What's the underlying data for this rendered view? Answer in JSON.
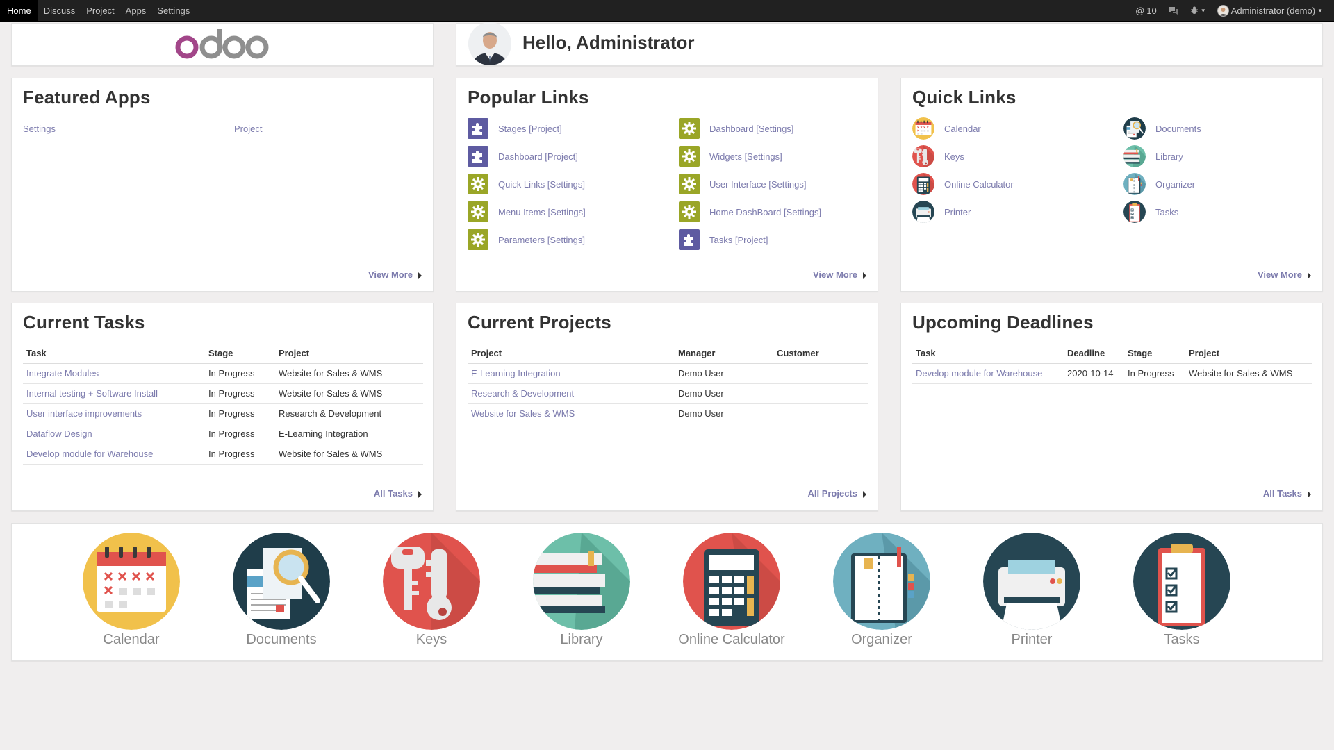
{
  "nav": {
    "items": [
      {
        "label": "Home",
        "active": true
      },
      {
        "label": "Discuss"
      },
      {
        "label": "Project"
      },
      {
        "label": "Apps"
      },
      {
        "label": "Settings"
      }
    ],
    "mentions": "10",
    "user": "Administrator (demo)"
  },
  "logo": {
    "text": "odoo"
  },
  "greeting": {
    "text": "Hello, Administrator"
  },
  "featured": {
    "title": "Featured Apps",
    "apps": [
      "Settings",
      "Project"
    ],
    "view_more": "View More"
  },
  "popular": {
    "title": "Popular Links",
    "links": [
      {
        "label": "Stages [Project]",
        "icon": "puzzle-icon"
      },
      {
        "label": "Dashboard [Project]",
        "icon": "puzzle-icon"
      },
      {
        "label": "Quick Links [Settings]",
        "icon": "gear-icon"
      },
      {
        "label": "Menu Items [Settings]",
        "icon": "gear-icon"
      },
      {
        "label": "Parameters [Settings]",
        "icon": "gear-icon"
      },
      {
        "label": "Dashboard [Settings]",
        "icon": "gear-icon"
      },
      {
        "label": "Widgets [Settings]",
        "icon": "gear-icon"
      },
      {
        "label": "User Interface [Settings]",
        "icon": "gear-icon"
      },
      {
        "label": "Home DashBoard [Settings]",
        "icon": "gear-icon"
      },
      {
        "label": "Tasks [Project]",
        "icon": "puzzle-icon"
      }
    ],
    "view_more": "View More"
  },
  "quick": {
    "title": "Quick Links",
    "links": [
      {
        "label": "Calendar",
        "icon": "calendar-icon"
      },
      {
        "label": "Keys",
        "icon": "keys-icon"
      },
      {
        "label": "Online Calculator",
        "icon": "calculator-icon"
      },
      {
        "label": "Printer",
        "icon": "printer-icon"
      },
      {
        "label": "Documents",
        "icon": "documents-icon"
      },
      {
        "label": "Library",
        "icon": "library-icon"
      },
      {
        "label": "Organizer",
        "icon": "organizer-icon"
      },
      {
        "label": "Tasks",
        "icon": "tasks-icon"
      }
    ],
    "view_more": "View More"
  },
  "tasks": {
    "title": "Current Tasks",
    "headers": [
      "Task",
      "Stage",
      "Project"
    ],
    "rows": [
      [
        "Integrate Modules",
        "In Progress",
        "Website for Sales & WMS"
      ],
      [
        "Internal testing + Software Install",
        "In Progress",
        "Website for Sales & WMS"
      ],
      [
        "User interface improvements",
        "In Progress",
        "Research & Development"
      ],
      [
        "Dataflow Design",
        "In Progress",
        "E-Learning Integration"
      ],
      [
        "Develop module for Warehouse",
        "In Progress",
        "Website for Sales & WMS"
      ]
    ],
    "footer": "All Tasks"
  },
  "projects": {
    "title": "Current Projects",
    "headers": [
      "Project",
      "Manager",
      "Customer"
    ],
    "rows": [
      [
        "E-Learning Integration",
        "Demo User",
        ""
      ],
      [
        "Research & Development",
        "Demo User",
        ""
      ],
      [
        "Website for Sales & WMS",
        "Demo User",
        ""
      ]
    ],
    "footer": "All Projects"
  },
  "deadlines": {
    "title": "Upcoming Deadlines",
    "headers": [
      "Task",
      "Deadline",
      "Stage",
      "Project"
    ],
    "rows": [
      [
        "Develop module for Warehouse",
        "2020-10-14",
        "In Progress",
        "Website for Sales & WMS"
      ]
    ],
    "footer": "All Tasks"
  },
  "apps": [
    {
      "label": "Calendar",
      "icon": "calendar-icon"
    },
    {
      "label": "Documents",
      "icon": "documents-icon"
    },
    {
      "label": "Keys",
      "icon": "keys-icon"
    },
    {
      "label": "Library",
      "icon": "library-icon"
    },
    {
      "label": "Online Calculator",
      "icon": "calculator-icon"
    },
    {
      "label": "Organizer",
      "icon": "organizer-icon"
    },
    {
      "label": "Printer",
      "icon": "printer-icon"
    },
    {
      "label": "Tasks",
      "icon": "tasks-icon"
    }
  ],
  "colors": {
    "navbar": "#212121",
    "link": "#7c7bad",
    "gear_bg": "#9aa627",
    "puzzle_bg": "#5e5ba1",
    "odoo_purple": "#a24689",
    "odoo_grey": "#8f8f8f"
  }
}
